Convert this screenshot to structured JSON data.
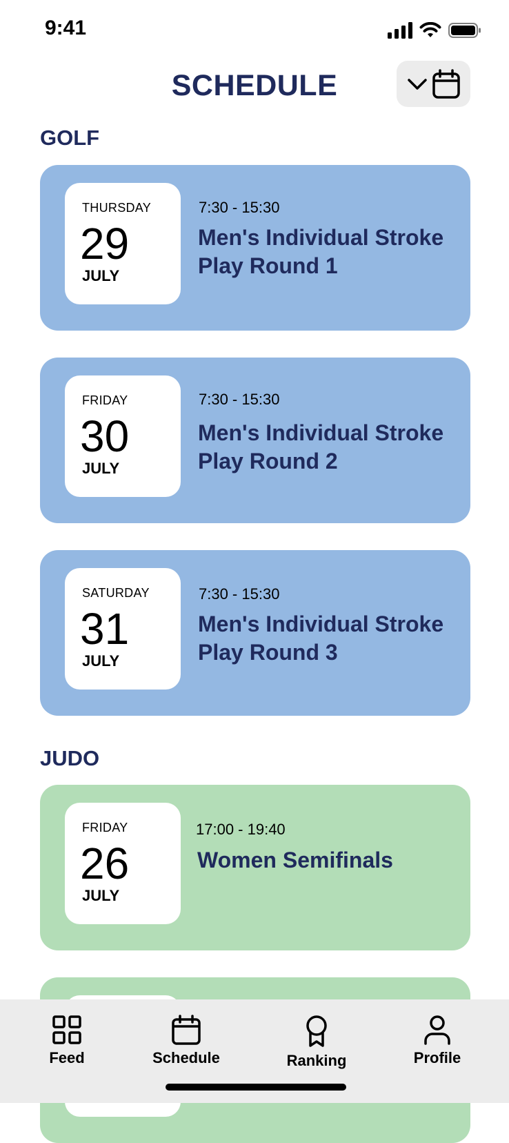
{
  "status_bar": {
    "time": "9:41"
  },
  "header": {
    "title": "SCHEDULE",
    "calendar_button": {
      "icons": [
        "chevron-down-icon",
        "calendar-icon"
      ]
    }
  },
  "sections": [
    {
      "title": "GOLF",
      "color": "#94b8e2",
      "events": [
        {
          "weekday": "THURSDAY",
          "day": "29",
          "month": "JULY",
          "time": "7:30 - 15:30",
          "title": "Men's Individual Stroke Play Round 1"
        },
        {
          "weekday": "FRIDAY",
          "day": "30",
          "month": "JULY",
          "time": "7:30 - 15:30",
          "title": "Men's Individual Stroke Play Round 2"
        },
        {
          "weekday": "SATURDAY",
          "day": "31",
          "month": "JULY",
          "time": "7:30 - 15:30",
          "title": "Men's Individual Stroke Play Round 3"
        }
      ]
    },
    {
      "title": "JUDO",
      "color": "#b3ddb7",
      "events": [
        {
          "weekday": "FRIDAY",
          "day": "26",
          "month": "JULY",
          "time": "17:00 - 19:40",
          "title": "Women Semifinals"
        }
      ]
    }
  ],
  "tab_bar": {
    "tabs": [
      {
        "label": "Feed",
        "icon": "grid-icon"
      },
      {
        "label": "Schedule",
        "icon": "calendar-icon"
      },
      {
        "label": "Ranking",
        "icon": "award-icon"
      },
      {
        "label": "Profile",
        "icon": "person-icon"
      }
    ]
  }
}
